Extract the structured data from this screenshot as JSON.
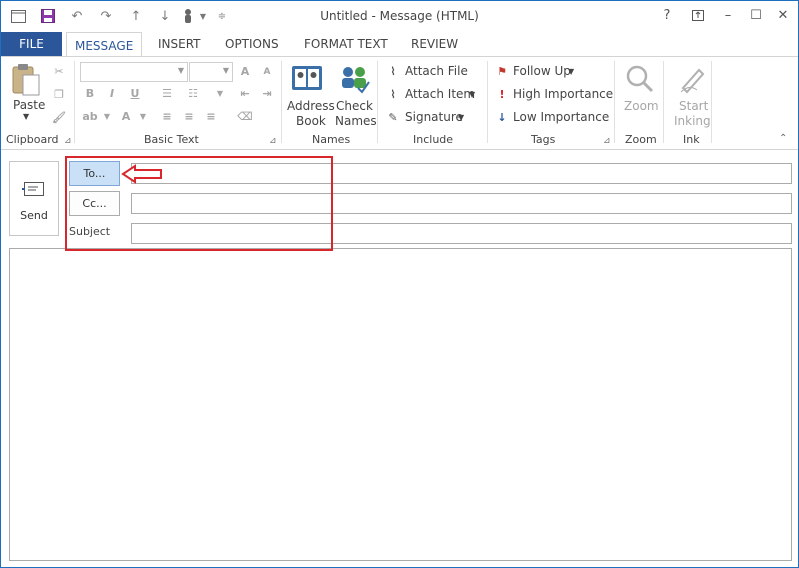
{
  "window": {
    "title": "Untitled - Message (HTML)"
  },
  "quick_access": [
    "save-icon",
    "undo-icon",
    "redo-icon",
    "up-icon",
    "down-icon",
    "touch-mode-icon",
    "customize-icon"
  ],
  "window_controls": {
    "help": "?",
    "restore": "ribbon-display-icon",
    "minimize": "–",
    "maximize": "☐",
    "close": "✕"
  },
  "tabs": {
    "file": "FILE",
    "message": "MESSAGE",
    "insert": "INSERT",
    "options": "OPTIONS",
    "format_text": "FORMAT TEXT",
    "review": "REVIEW"
  },
  "ribbon": {
    "clipboard": {
      "label": "Clipboard",
      "paste": "Paste"
    },
    "basic_text": {
      "label": "Basic Text",
      "bold": "B",
      "italic": "I",
      "underline": "U"
    },
    "names": {
      "label": "Names",
      "address_book": [
        "Address",
        "Book"
      ],
      "check_names": [
        "Check",
        "Names"
      ]
    },
    "include": {
      "label": "Include",
      "attach_file": "Attach File",
      "attach_item": "Attach Item",
      "signature": "Signature"
    },
    "tags": {
      "label": "Tags",
      "follow_up": "Follow Up",
      "high_importance": "High Importance",
      "low_importance": "Low Importance"
    },
    "zoom": {
      "label": "Zoom",
      "zoom": "Zoom"
    },
    "ink": {
      "label": "Ink",
      "start_inking": [
        "Start",
        "Inking"
      ]
    }
  },
  "compose": {
    "send": "Send",
    "to_button": "To...",
    "cc_button": "Cc...",
    "subject_label": "Subject",
    "to_value": "",
    "cc_value": "",
    "subject_value": "",
    "body_value": ""
  },
  "colors": {
    "accent": "#2b579a",
    "highlight": "#d9262c"
  }
}
